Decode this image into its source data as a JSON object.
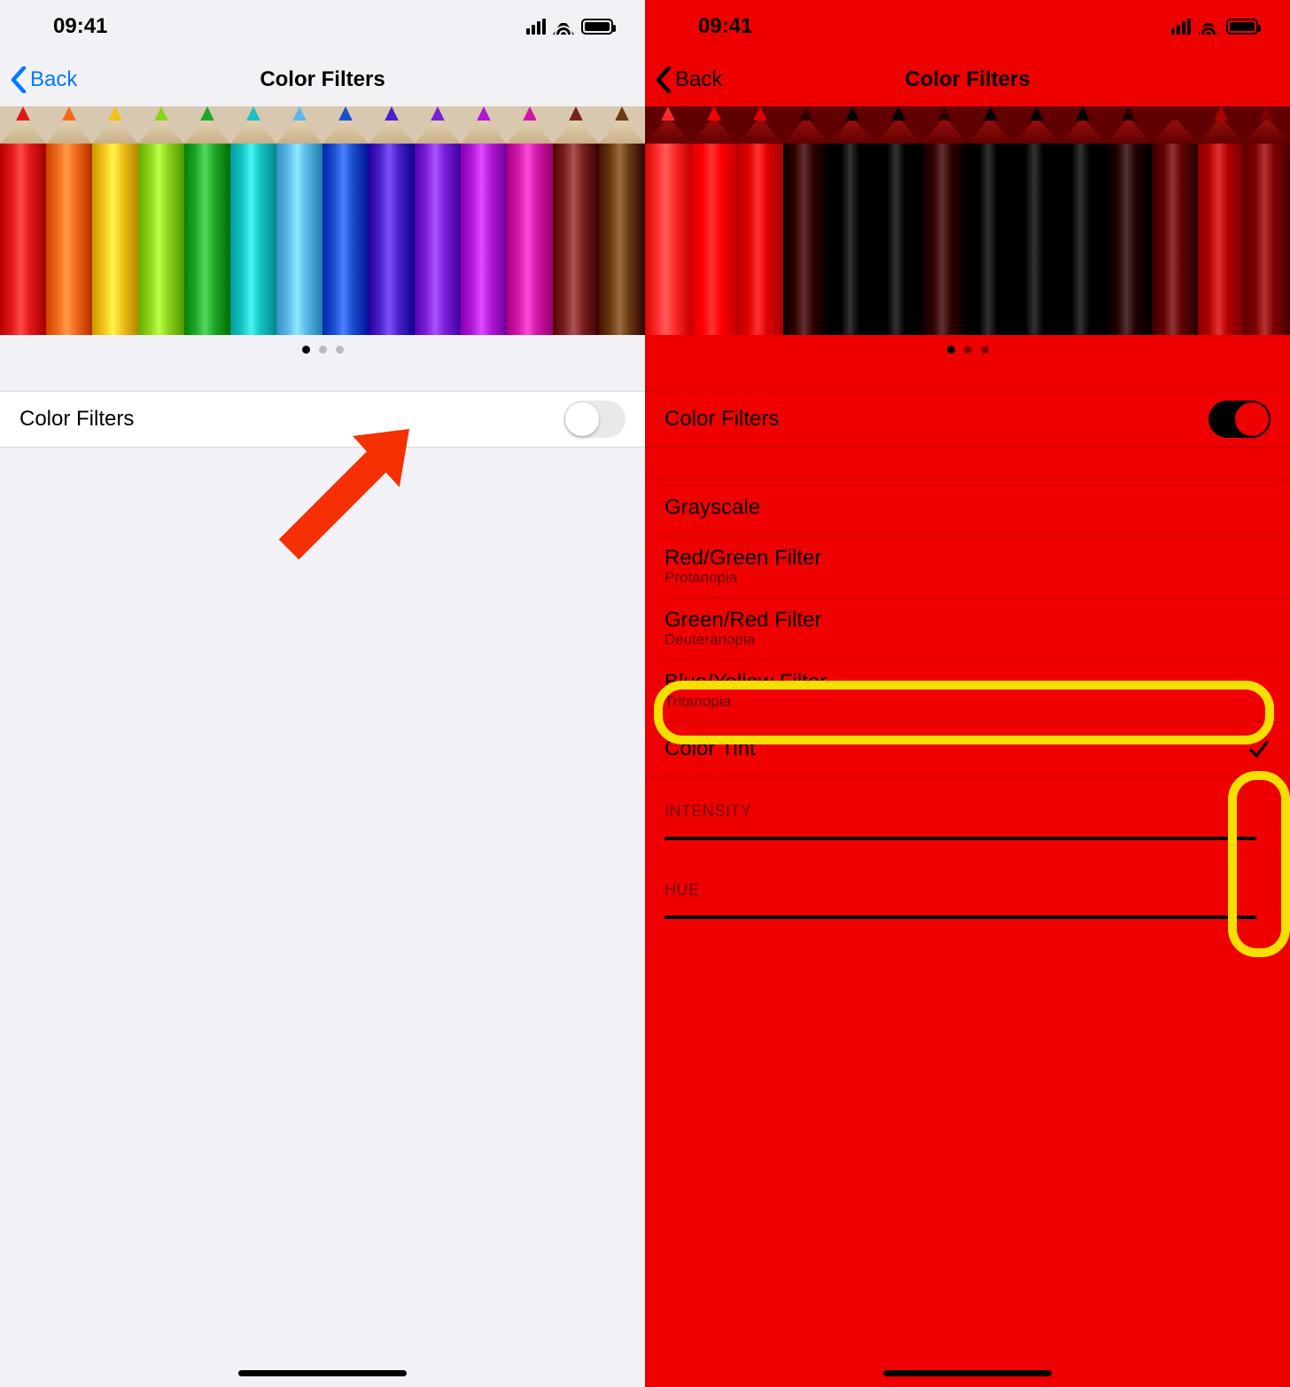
{
  "statusTime": "09:41",
  "left": {
    "backLabel": "Back",
    "title": "Color Filters",
    "toggleLabel": "Color Filters",
    "toggleOn": false,
    "pencilColors": [
      "#e01818",
      "#f06a1a",
      "#f2c21a",
      "#8bd41a",
      "#1fa82a",
      "#16c3c3",
      "#5bb8e8",
      "#1a4fd0",
      "#4a20c8",
      "#7a20d8",
      "#b018d8",
      "#d018a8",
      "#7a2020",
      "#6a3a10"
    ]
  },
  "right": {
    "backLabel": "Back",
    "title": "Color Filters",
    "toggleLabel": "Color Filters",
    "toggleOn": true,
    "pencilColors": [
      "#ff2a2a",
      "#ff0000",
      "#e00000",
      "#300000",
      "#000000",
      "#000000",
      "#300000",
      "#000000",
      "#000000",
      "#000000",
      "#200000",
      "#600000",
      "#b00000",
      "#800000"
    ],
    "filterOptions": [
      {
        "label": "Grayscale",
        "sub": ""
      },
      {
        "label": "Red/Green Filter",
        "sub": "Protanopia"
      },
      {
        "label": "Green/Red Filter",
        "sub": "Deuteranopia"
      },
      {
        "label": "Blue/Yellow Filter",
        "sub": "Tritanopia"
      },
      {
        "label": "Color Tint",
        "sub": "",
        "selected": true
      }
    ],
    "intensityLabel": "INTENSITY",
    "hueLabel": "HUE"
  }
}
